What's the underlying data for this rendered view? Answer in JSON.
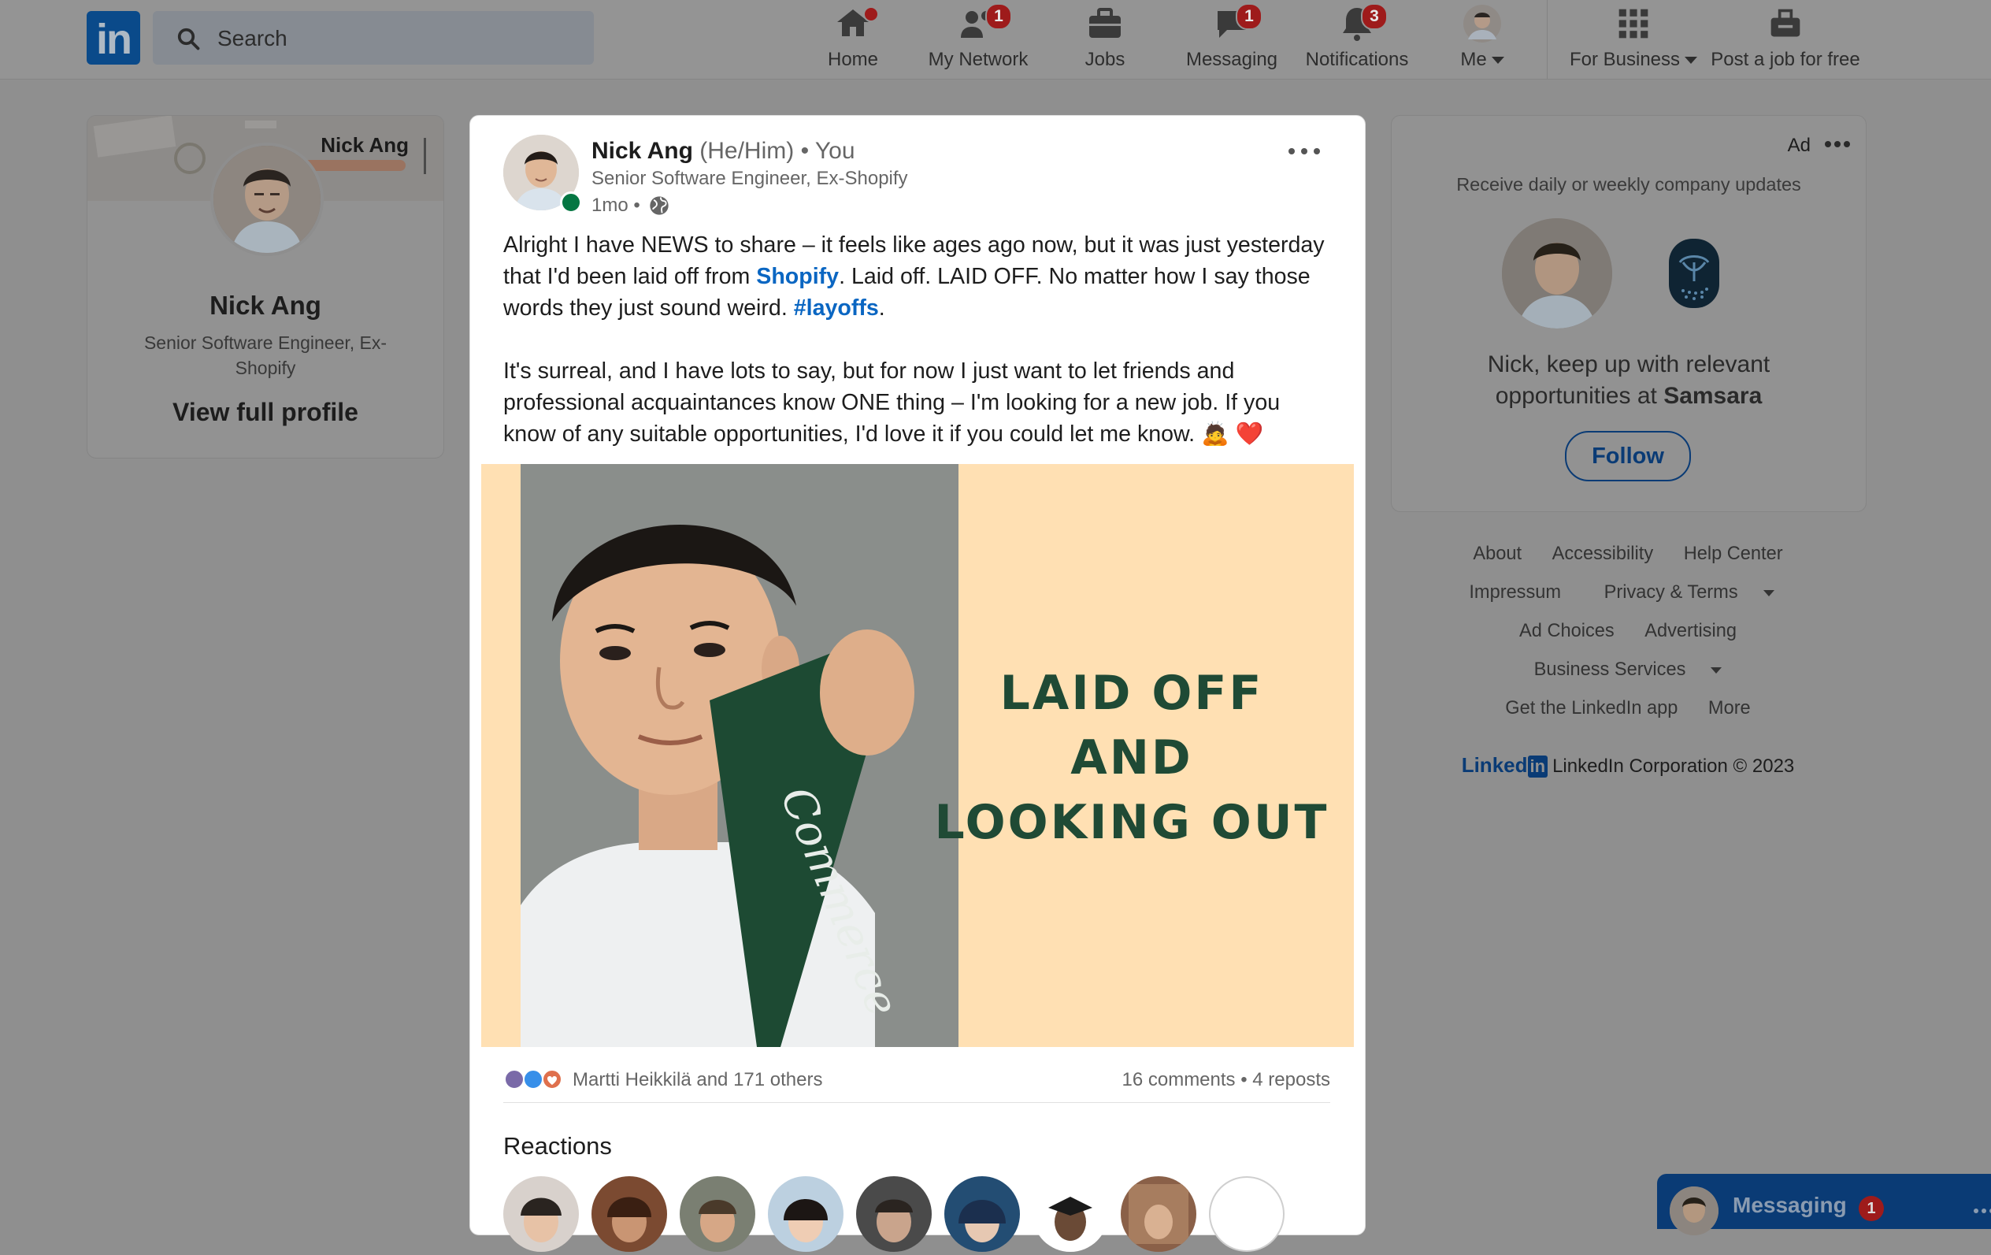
{
  "nav": {
    "search_placeholder": "Search",
    "items": [
      {
        "label": "Home",
        "icon": "home-icon",
        "badge": null,
        "dot": true
      },
      {
        "label": "My Network",
        "icon": "network-icon",
        "badge": "1"
      },
      {
        "label": "Jobs",
        "icon": "briefcase-icon",
        "badge": null
      },
      {
        "label": "Messaging",
        "icon": "chat-icon",
        "badge": "1"
      },
      {
        "label": "Notifications",
        "icon": "bell-icon",
        "badge": "3"
      },
      {
        "label": "Me",
        "icon": "avatar"
      }
    ],
    "for_business": "For Business",
    "post_job": "Post a job for free"
  },
  "profile": {
    "cover_name": "Nick Ang",
    "name": "Nick Ang",
    "headline": "Senior Software Engineer, Ex-Shopify",
    "link": "View full profile"
  },
  "post": {
    "author": "Nick Ang",
    "pronouns": "(He/Him)",
    "you": "• You",
    "headline": "Senior Software Engineer, Ex-Shopify",
    "time": "1mo •",
    "text1_a": "Alright I have NEWS to share – it feels like ages ago now, but it was just yesterday that I'd been laid off from ",
    "text1_link": "Shopify",
    "text1_b": ". Laid off. LAID OFF. No matter how I say those words they just sound weird. ",
    "text1_hashtag": "#layoffs",
    "text1_c": ".",
    "text2": "It's surreal, and I have lots to say, but for now I just want to let friends and professional acquaintances know ONE thing – I'm looking for a new job. If you know of any suitable opportunities, I'd love it if you could let me know. 🙇 ❤️",
    "image_caption_1": "LAID OFF",
    "image_caption_2": "AND",
    "image_caption_3": "LOOKING OUT",
    "pennant_text": "MAKE Commerce BETTER FOR Everyone",
    "reactor": "Martti Heikkilä and 171 others",
    "counts": "16 comments • 4 reposts",
    "reactions_title": "Reactions"
  },
  "ad": {
    "label": "Ad",
    "subtitle": "Receive daily or weekly company updates",
    "text_a": "Nick, keep up with relevant opportunities at ",
    "company": "Samsara",
    "follow": "Follow"
  },
  "footer": {
    "about": "About",
    "accessibility": "Accessibility",
    "help": "Help Center",
    "impressum": "Impressum",
    "privacy": "Privacy & Terms",
    "ad_choices": "Ad Choices",
    "advertising": "Advertising",
    "business": "Business Services",
    "app": "Get the LinkedIn app",
    "more": "More",
    "brand": "Linked",
    "copyright": "LinkedIn Corporation © 2023"
  },
  "messaging": {
    "label": "Messaging",
    "badge": "1"
  },
  "colors": {
    "accent": "#0a66c2",
    "badge": "#9e1b1b",
    "image_bg": "#ffe0b3",
    "caption": "#1f4a35"
  }
}
